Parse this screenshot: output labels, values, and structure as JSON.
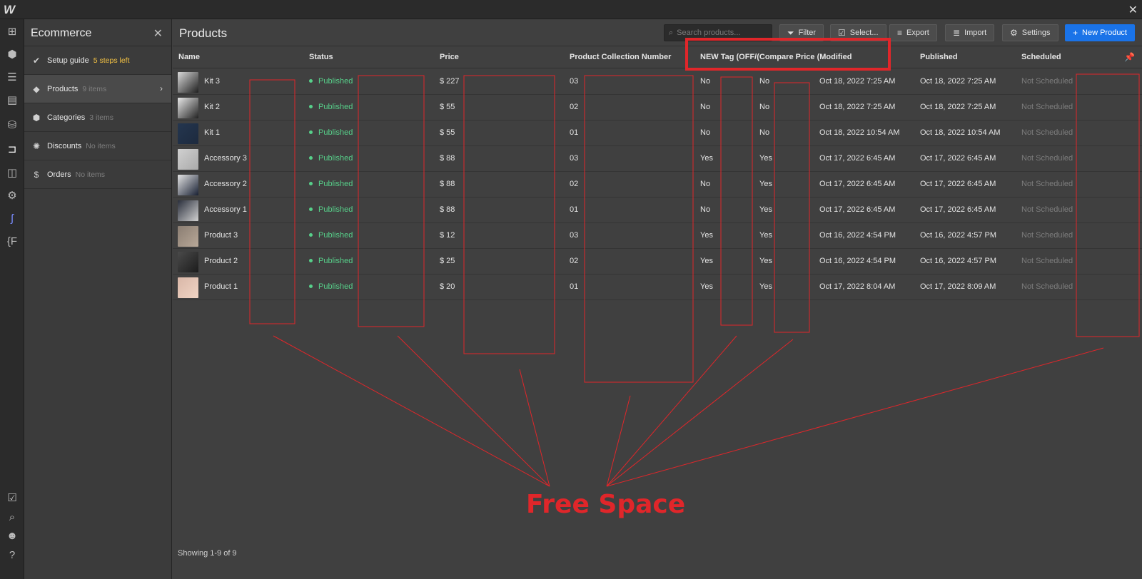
{
  "app": {
    "logo": "W"
  },
  "panel": {
    "title": "Ecommerce",
    "items": [
      {
        "label": "Setup guide",
        "count": "5 steps left",
        "icon": "check-circle-icon"
      },
      {
        "label": "Products",
        "count": "9 items",
        "icon": "tag-icon"
      },
      {
        "label": "Categories",
        "count": "3 items",
        "icon": "box-icon"
      },
      {
        "label": "Discounts",
        "count": "No items",
        "icon": "discount-icon"
      },
      {
        "label": "Orders",
        "count": "No items",
        "icon": "dollar-icon"
      }
    ]
  },
  "main": {
    "title": "Products",
    "search_placeholder": "Search products...",
    "toolbar": {
      "filter": "Filter",
      "select": "Select...",
      "export": "Export",
      "import": "Import",
      "settings": "Settings",
      "new_product": "New Product"
    },
    "columns": [
      "Name",
      "Status",
      "Price",
      "Product Collection Number",
      "NEW Tag (OFF/(Compare Price (Modified",
      "Published",
      "Scheduled"
    ],
    "rows": [
      {
        "name": "Kit 3",
        "status": "Published",
        "price": "$ 227",
        "pcn": "03",
        "tag": "No",
        "cmp": "No",
        "modified": "Oct 18, 2022 7:25 AM",
        "published": "Oct 18, 2022 7:25 AM",
        "scheduled": "Not Scheduled"
      },
      {
        "name": "Kit 2",
        "status": "Published",
        "price": "$ 55",
        "pcn": "02",
        "tag": "No",
        "cmp": "No",
        "modified": "Oct 18, 2022 7:25 AM",
        "published": "Oct 18, 2022 7:25 AM",
        "scheduled": "Not Scheduled"
      },
      {
        "name": "Kit 1",
        "status": "Published",
        "price": "$ 55",
        "pcn": "01",
        "tag": "No",
        "cmp": "No",
        "modified": "Oct 18, 2022 10:54 AM",
        "published": "Oct 18, 2022 10:54 AM",
        "scheduled": "Not Scheduled"
      },
      {
        "name": "Accessory 3",
        "status": "Published",
        "price": "$ 88",
        "pcn": "03",
        "tag": "Yes",
        "cmp": "Yes",
        "modified": "Oct 17, 2022 6:45 AM",
        "published": "Oct 17, 2022 6:45 AM",
        "scheduled": "Not Scheduled"
      },
      {
        "name": "Accessory 2",
        "status": "Published",
        "price": "$ 88",
        "pcn": "02",
        "tag": "No",
        "cmp": "Yes",
        "modified": "Oct 17, 2022 6:45 AM",
        "published": "Oct 17, 2022 6:45 AM",
        "scheduled": "Not Scheduled"
      },
      {
        "name": "Accessory 1",
        "status": "Published",
        "price": "$ 88",
        "pcn": "01",
        "tag": "No",
        "cmp": "Yes",
        "modified": "Oct 17, 2022 6:45 AM",
        "published": "Oct 17, 2022 6:45 AM",
        "scheduled": "Not Scheduled"
      },
      {
        "name": "Product 3",
        "status": "Published",
        "price": "$ 12",
        "pcn": "03",
        "tag": "Yes",
        "cmp": "Yes",
        "modified": "Oct 16, 2022 4:54 PM",
        "published": "Oct 16, 2022 4:57 PM",
        "scheduled": "Not Scheduled"
      },
      {
        "name": "Product 2",
        "status": "Published",
        "price": "$ 25",
        "pcn": "02",
        "tag": "Yes",
        "cmp": "Yes",
        "modified": "Oct 16, 2022 4:54 PM",
        "published": "Oct 16, 2022 4:57 PM",
        "scheduled": "Not Scheduled"
      },
      {
        "name": "Product 1",
        "status": "Published",
        "price": "$ 20",
        "pcn": "01",
        "tag": "Yes",
        "cmp": "Yes",
        "modified": "Oct 17, 2022 8:04 AM",
        "published": "Oct 17, 2022 8:09 AM",
        "scheduled": "Not Scheduled"
      }
    ],
    "footer": "Showing 1-9 of 9"
  },
  "annotation": {
    "label": "Free Space",
    "color": "#e0262a"
  },
  "colors": {
    "accent": "#1a73e8",
    "status_published": "#57d08a",
    "setup_count": "#f5c343"
  }
}
